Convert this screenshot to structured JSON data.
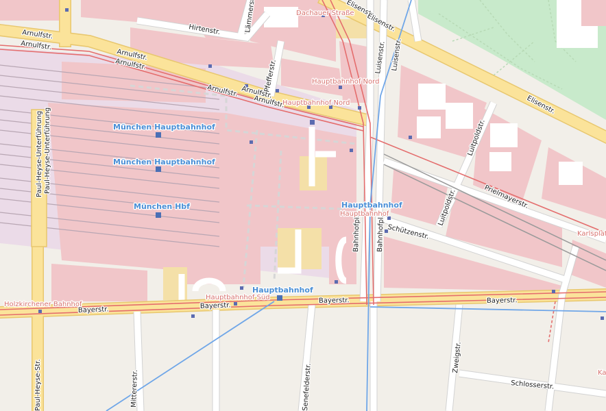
{
  "map": {
    "colors": {
      "background": "#f2efe9",
      "railway_area": "#ebdbe8",
      "building": "#f1c6c9",
      "park": "#c8eacb",
      "major_road": "#fbe39a",
      "road": "#ffffff",
      "tram": "#e46d6d",
      "subway": "#6fa6e8",
      "station_label": "#4a8fd6",
      "stop_label": "#d7736f"
    },
    "streets": {
      "hirtenstr": "Hirtenstr.",
      "lammerstr": "Lämmerstr.",
      "dachauer_strasse": "Dachauer Straße",
      "elisenstr": "Elisenstr.",
      "arnulfstr": "Arnulfstr.",
      "pfefferstr": "Pfefferstr.",
      "luisenstr": "Luisenstr.",
      "lutpoldstr": "Luitpoldstr.",
      "prielmayerstr": "Prielmayerstr.",
      "karlsplatz": "Karlsplat",
      "schutzenstr": "Schützenstr.",
      "bahnhofpl": "Bahnhofpl.",
      "bayerstr": "Bayerstr.",
      "paul_heyse_unterfuhrung": "Paul-Heyse-Unterführung",
      "paul_heyse_str": "Paul-Heyse-Str.",
      "mittererstr": "Mittererstr.",
      "senefelderstr": "Senefelderstr.",
      "zweigstr": "Zweigstr.",
      "schlosserstr": "Schlosserstr.",
      "ka_fragment": "Ka"
    },
    "stations": {
      "munchen_hauptbahnhof": "München Hauptbahnhof",
      "munchen_hbf": "München Hbf",
      "hauptbahnhof": "Hauptbahnhof"
    },
    "stops": {
      "dachauer_strasse": "Dachauer Straße",
      "hauptbahnhof_nord": "Hauptbahnhof Nord",
      "hauptbahnhof_sud": "Hauptbahnhof Süd",
      "hauptbahnhof": "Hauptbahnhof",
      "holzkirchener_bahnhof": "Holzkirchener Bahnhof"
    },
    "icons": [
      "transit-stop-icon",
      "station-icon"
    ]
  }
}
